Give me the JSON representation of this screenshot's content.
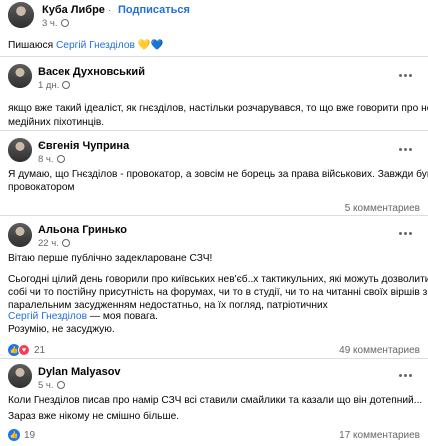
{
  "post": {
    "author": "Куба Либре",
    "separator": "·",
    "follow_label": "Подписаться",
    "time": "3 ч.",
    "text_prefix": "Пишаюся ",
    "text_link": "Сергій Гнезділов",
    "text_emoji": "💛💙"
  },
  "comments": [
    {
      "author": "Васек Духновський",
      "time": "1 дн.",
      "lines": [
        "якщо вже такий ідеаліст, як гнєзділов, настільки розчарувався, то що вже говорити про не",
        "медійних піхотинців."
      ]
    },
    {
      "author": "Євгенія Чуприна",
      "time": "8 ч.",
      "lines": [
        "Я думаю, що Гнєзділов -  провокатор, а зовсім не борець за права військових. Завжди був",
        "провокатором"
      ],
      "comment_count": "5 комментариев"
    },
    {
      "author": "Альона Гринько",
      "time": "22 ч.",
      "lines": [
        "Вітаю перше публічно задеклароване СЗЧ!",
        "",
        "Сьогодні цілий день говорили про київських нев'єб..х тактикульних, які можуть дозволити",
        "собі чи то постійну присутність на форумах, чи то в студії, чи то на читанні своїх віршів з",
        "паралельним засудженням недостатньо, на їх погляд, патріотичних",
        "",
        "— моя повага.",
        "Розумію, не засуджую."
      ],
      "mention": "Сергій Гнезділов",
      "reaction_count": "21",
      "comment_count": "49 комментариев"
    },
    {
      "author": "Dylan Malyasov",
      "time": "5 ч.",
      "lines": [
        "Коли Гнезділов писав про намір СЗЧ всі ставили смайлики та казали що він дотепний",
        "...",
        "Зараз вже нікому не смішно більше."
      ],
      "reaction_count": "19",
      "comment_count": "17 комментариев"
    }
  ],
  "colors": {
    "link": "#216fdb",
    "meta": "#65676b",
    "like": "#1877f2",
    "heart": "#f33e58"
  }
}
